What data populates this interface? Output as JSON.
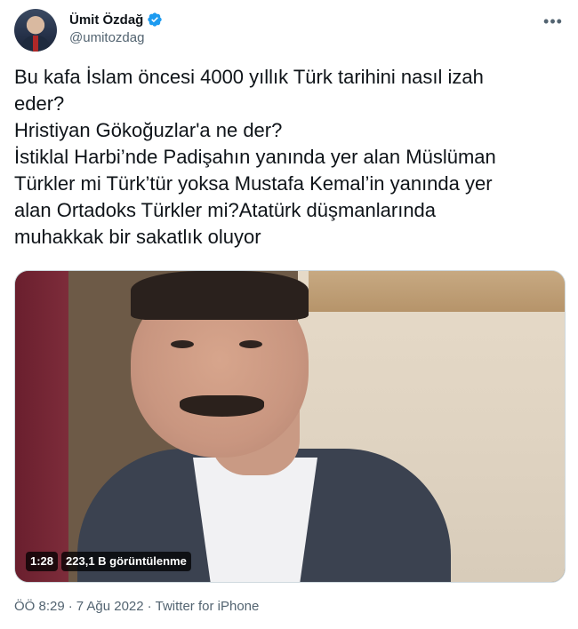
{
  "author": {
    "display_name": "Ümit Özdağ",
    "handle": "@umitozdag",
    "verified": true,
    "avatar_icon": "profile-photo"
  },
  "header": {
    "more_icon": "more-horizontal-icon"
  },
  "tweet": {
    "text": "Bu kafa İslam öncesi 4000 yıllık Türk tarihini nasıl izah\neder?\nHristiyan Gökoğuzlar'a ne der?\nİstiklal Harbi’nde Padişahın yanında yer alan Müslüman\nTürkler mi Türk’tür yoksa Mustafa Kemal’in yanında yer\nalan Ortadoks Türkler mi?Atatürk düşmanlarında\nmuhakkak bir sakatlık oluyor"
  },
  "media": {
    "type": "video",
    "duration": "1:28",
    "views": "223,1 B görüntülenme"
  },
  "meta": {
    "time": "ÖÖ 8:29",
    "separator1": "·",
    "date": "7 Ağu 2022",
    "separator2": "·",
    "source": "Twitter for iPhone"
  },
  "colors": {
    "text_primary": "#0f1419",
    "text_secondary": "#536471",
    "verified_blue": "#1d9bf0"
  }
}
